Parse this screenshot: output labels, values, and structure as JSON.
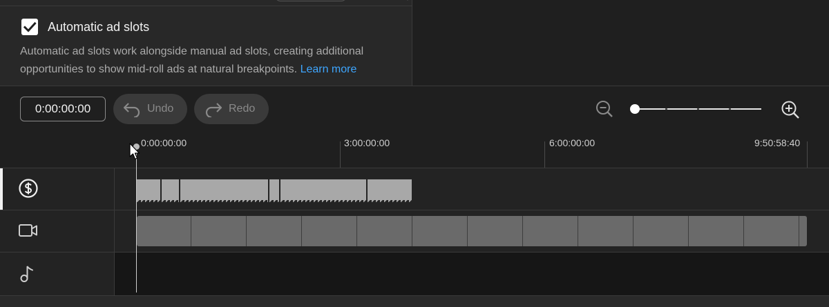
{
  "settings": {
    "checkbox_checked": true,
    "title": "Automatic ad slots",
    "description": "Automatic ad slots work alongside manual ad slots, creating additional opportunities to show mid-roll ads at natural breakpoints.",
    "learn_more": "Learn more"
  },
  "toolbar": {
    "timecode": "0:00:00:00",
    "undo_label": "Undo",
    "redo_label": "Redo",
    "zoom_level": 0.0
  },
  "ruler": {
    "labels": [
      "0:00:00:00",
      "3:00:00:00",
      "6:00:00:00",
      "9:50:58:40"
    ]
  },
  "tracks": {
    "ads": {
      "icon": "dollar-circle-icon"
    },
    "video": {
      "icon": "video-camera-icon"
    },
    "audio": {
      "icon": "music-note-icon"
    }
  },
  "colors": {
    "accent_link": "#3ea6ff",
    "background": "#1f1f1f",
    "panel": "#282828",
    "ad_segment": "#a8a8a8",
    "video_strip": "#6a6a6a"
  }
}
